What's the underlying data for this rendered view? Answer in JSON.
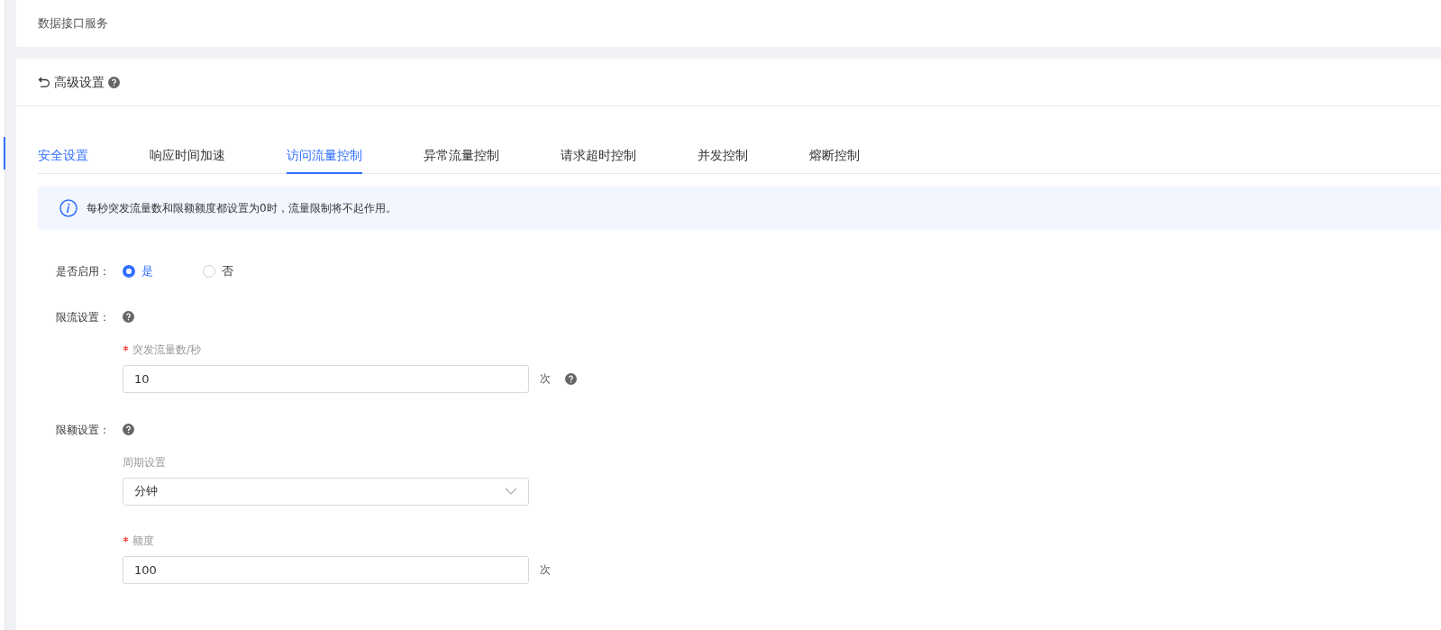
{
  "breadcrumb": "数据接口服务",
  "panel": {
    "title": "高级设置"
  },
  "tabs": [
    {
      "label": "安全设置",
      "selected": false,
      "highlighted": true
    },
    {
      "label": "响应时间加速",
      "selected": false,
      "highlighted": false
    },
    {
      "label": "访问流量控制",
      "selected": true,
      "highlighted": false
    },
    {
      "label": "异常流量控制",
      "selected": false,
      "highlighted": false
    },
    {
      "label": "请求超时控制",
      "selected": false,
      "highlighted": false
    },
    {
      "label": "并发控制",
      "selected": false,
      "highlighted": false
    },
    {
      "label": "熔断控制",
      "selected": false,
      "highlighted": false
    }
  ],
  "alert": "每秒突发流量数和限额额度都设置为0时，流量限制将不起作用。",
  "enable": {
    "label": "是否启用：",
    "options": [
      {
        "label": "是",
        "selected": true
      },
      {
        "label": "否",
        "selected": false
      }
    ]
  },
  "sections": [
    {
      "label": "限流设置：",
      "fields": [
        {
          "kind": "input",
          "label": "突发流量数/秒",
          "required": true,
          "value": "10",
          "unit": "次",
          "help": true
        }
      ]
    },
    {
      "label": "限额设置：",
      "fields": [
        {
          "kind": "select",
          "label": "周期设置",
          "required": false,
          "value": "分钟"
        },
        {
          "kind": "input",
          "label": "额度",
          "required": true,
          "value": "100",
          "unit": "次",
          "help": false
        }
      ]
    }
  ]
}
